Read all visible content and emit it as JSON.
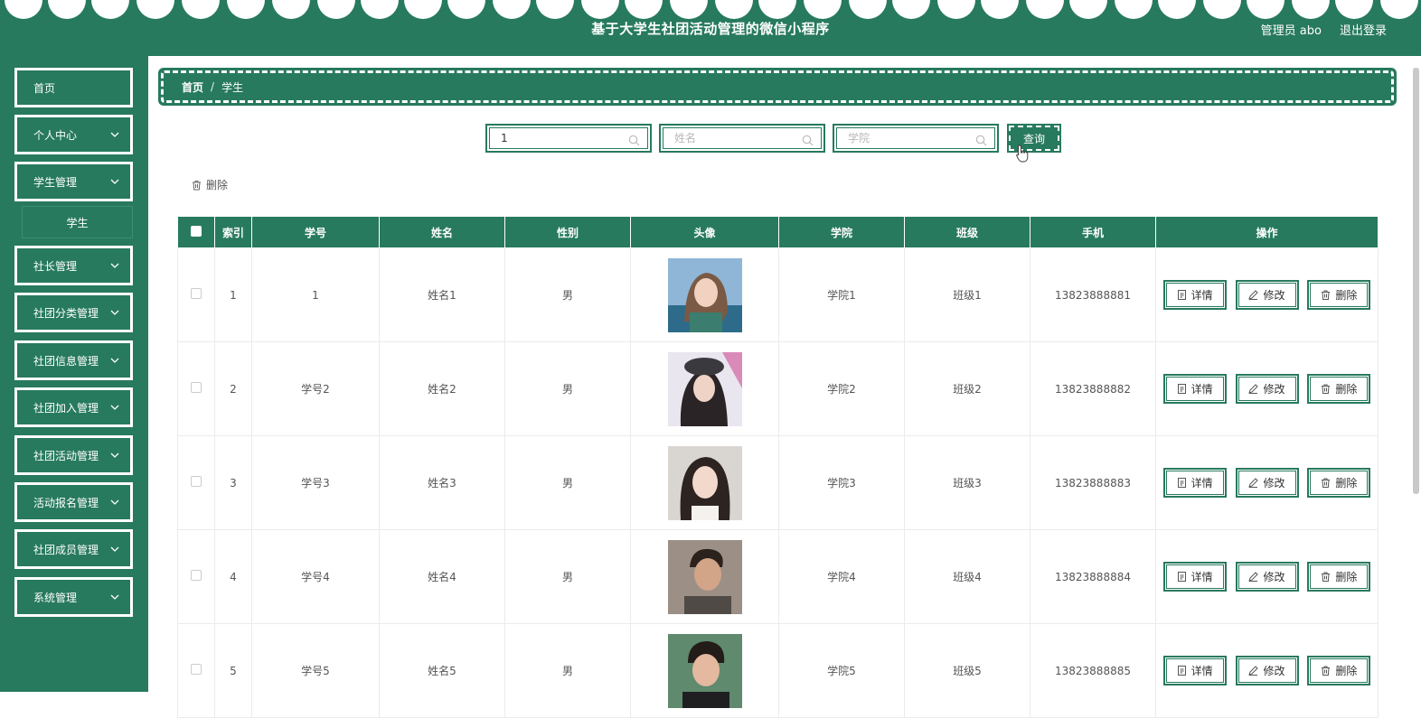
{
  "header": {
    "title": "基于大学生社团活动管理的微信小程序",
    "user_label": "管理员 abo",
    "logout_label": "退出登录"
  },
  "sidebar": {
    "items": [
      {
        "label": "首页"
      },
      {
        "label": "个人中心"
      },
      {
        "label": "学生管理"
      },
      {
        "label": "社长管理"
      },
      {
        "label": "社团分类管理"
      },
      {
        "label": "社团信息管理"
      },
      {
        "label": "社团加入管理"
      },
      {
        "label": "社团活动管理"
      },
      {
        "label": "活动报名管理"
      },
      {
        "label": "社团成员管理"
      },
      {
        "label": "系统管理"
      }
    ],
    "sub_item": "学生"
  },
  "breadcrumb": {
    "home": "首页",
    "sep": "/",
    "current": "学生"
  },
  "search": {
    "student_no_value": "1",
    "name_placeholder": "姓名",
    "college_placeholder": "学院",
    "query_label": "查询"
  },
  "toolbar": {
    "delete_label": "删除"
  },
  "table": {
    "headers": {
      "index": "索引",
      "student_no": "学号",
      "name": "姓名",
      "gender": "性别",
      "avatar": "头像",
      "college": "学院",
      "class": "班级",
      "phone": "手机",
      "actions": "操作"
    },
    "actions": {
      "detail": "详情",
      "edit": "修改",
      "delete": "删除"
    },
    "rows": [
      {
        "index": "1",
        "student_no": "1",
        "name": "姓名1",
        "gender": "男",
        "college": "学院1",
        "class": "班级1",
        "phone": "13823888881"
      },
      {
        "index": "2",
        "student_no": "学号2",
        "name": "姓名2",
        "gender": "男",
        "college": "学院2",
        "class": "班级2",
        "phone": "13823888882"
      },
      {
        "index": "3",
        "student_no": "学号3",
        "name": "姓名3",
        "gender": "男",
        "college": "学院3",
        "class": "班级3",
        "phone": "13823888883"
      },
      {
        "index": "4",
        "student_no": "学号4",
        "name": "姓名4",
        "gender": "男",
        "college": "学院4",
        "class": "班级4",
        "phone": "13823888884"
      },
      {
        "index": "5",
        "student_no": "学号5",
        "name": "姓名5",
        "gender": "男",
        "college": "学院5",
        "class": "班级5",
        "phone": "13823888885"
      }
    ]
  },
  "colors": {
    "primary": "#277a5d",
    "white": "#ffffff"
  }
}
